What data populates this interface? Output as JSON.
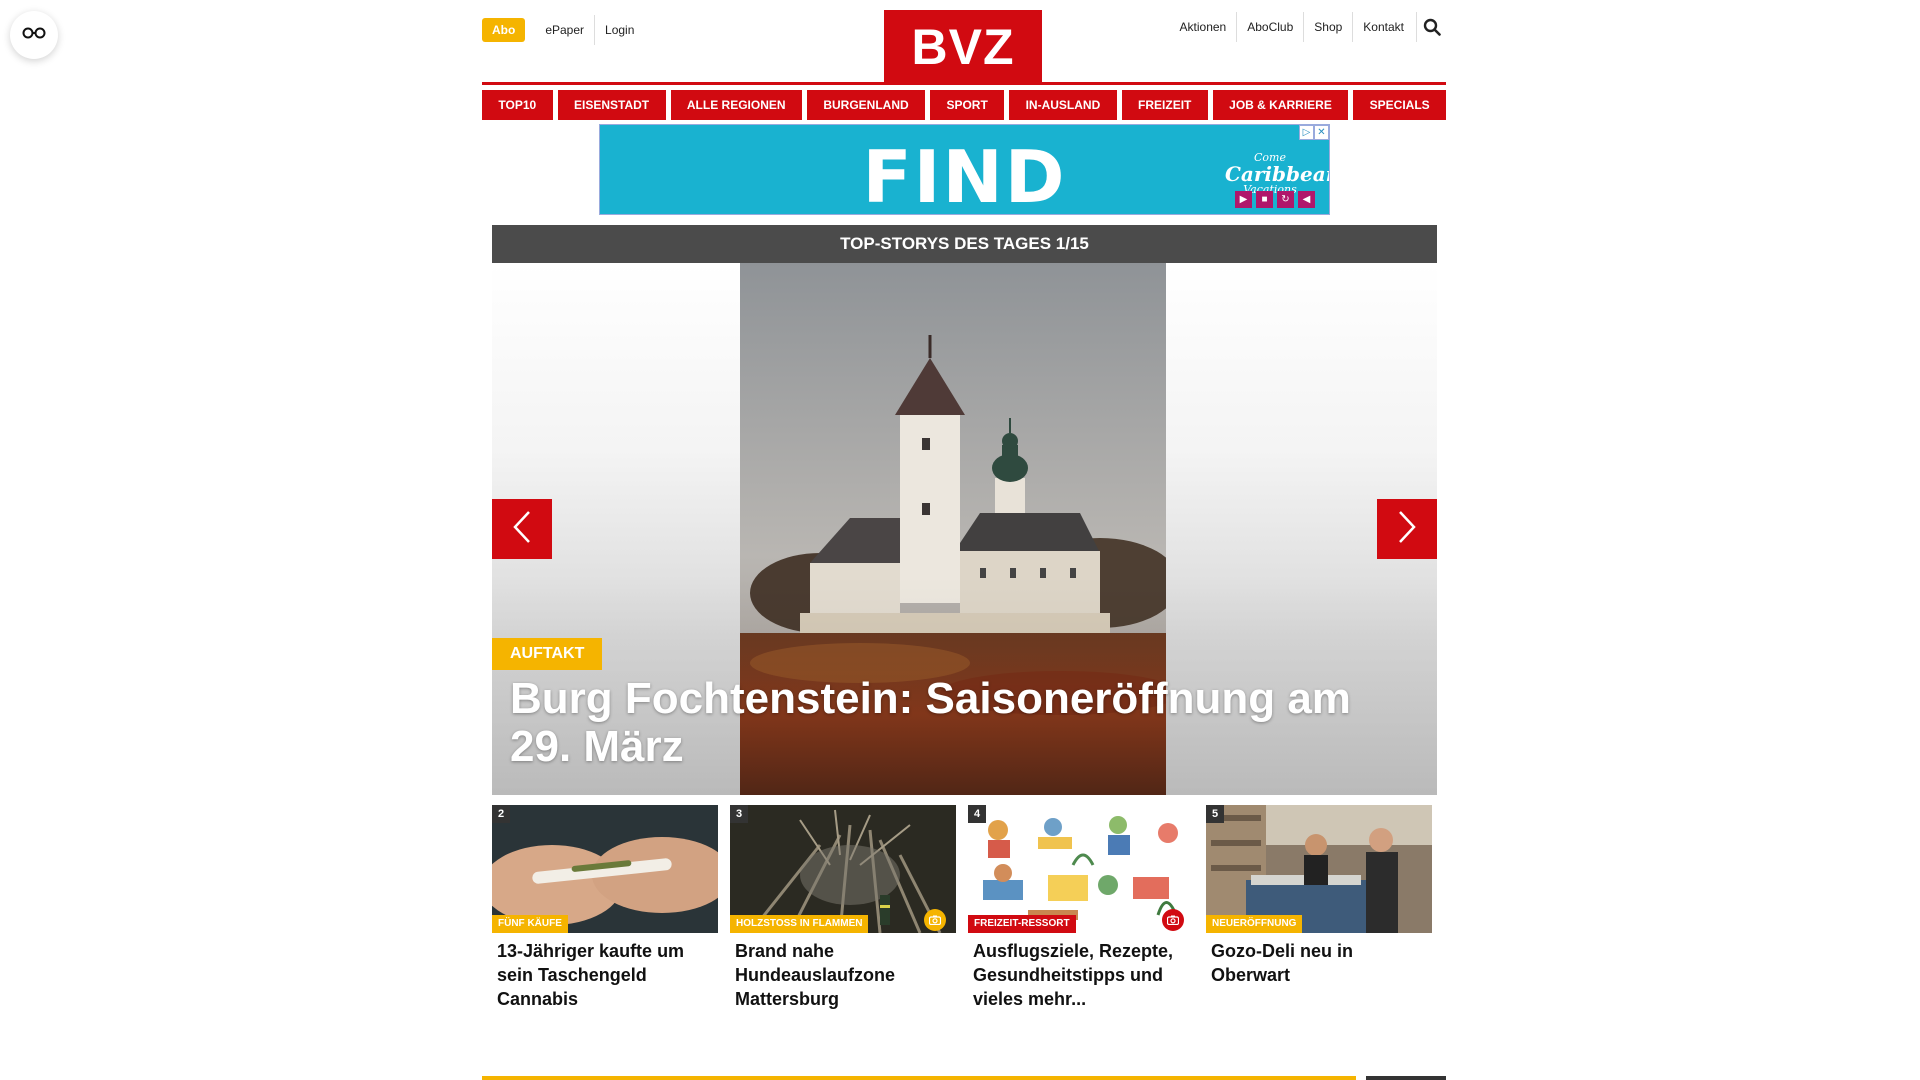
{
  "colors": {
    "brand_red": "#d10a11",
    "accent_yellow": "#f5b400",
    "dark_bar": "#4b4b4b",
    "ad_cyan": "#19b2d0"
  },
  "reader_button": {
    "icon": "glasses-icon"
  },
  "header": {
    "abo_label": "Abo",
    "left_links": [
      "ePaper",
      "Login"
    ],
    "logo_text": "BVZ",
    "right_links": [
      "Aktionen",
      "AboClub",
      "Shop",
      "Kontakt"
    ],
    "search_icon": "search-icon"
  },
  "nav": {
    "items": [
      "TOP10",
      "EISENSTADT",
      "ALLE REGIONEN",
      "BURGENLAND",
      "SPORT",
      "IN-AUSLAND",
      "FREIZEIT",
      "JOB & KARRIERE",
      "SPECIALS"
    ]
  },
  "ad": {
    "headline": "FIND",
    "brand_top": "Come",
    "brand_main": "Caribbean",
    "brand_bottom": "Vacations",
    "controls": [
      "play-icon",
      "stop-icon",
      "replay-icon",
      "mute-icon"
    ]
  },
  "top_stories": {
    "heading": "TOP-STORYS DES TAGES 1/15",
    "hero": {
      "kicker": "AUFTAKT",
      "title": "Burg Fochtenstein: Saisoneröffnung am 29. März"
    },
    "cards": [
      {
        "num": "2",
        "tag": "FÜNF KÄUFE",
        "tag_color": "yellow",
        "title": "13-Jähriger kaufte um sein Taschengeld Cannabis",
        "camera": false
      },
      {
        "num": "3",
        "tag": "HOLZSTOSS IN FLAMMEN",
        "tag_color": "yellow",
        "title": "Brand nahe Hundeauslaufzone Mattersburg",
        "camera": true
      },
      {
        "num": "4",
        "tag": "FREIZEIT-RESSORT",
        "tag_color": "red",
        "title": "Ausflugsziele, Rezepte, Gesundheitstipps und vieles mehr...",
        "camera": true
      },
      {
        "num": "5",
        "tag": "NEUERÖFFNUNG",
        "tag_color": "yellow",
        "title": "Gozo-Deli neu in Oberwart",
        "camera": false
      }
    ]
  }
}
